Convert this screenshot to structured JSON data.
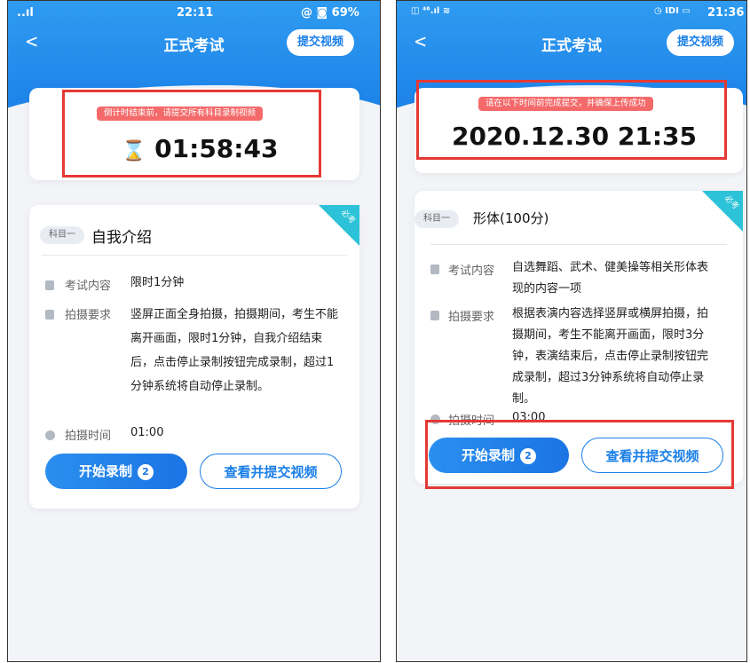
{
  "left": {
    "status": {
      "time": "22:11",
      "battery": "@ ◙ 69%",
      "signal": "..ıl"
    },
    "nav": {
      "back": "<",
      "title": "正式考试",
      "submit": "提交视频"
    },
    "timer": {
      "notice": "倒计时结束前，请提交所有科目录制视频",
      "icon": "hourglass-icon",
      "hourglass": "⌛",
      "value": "01:58:43"
    },
    "subject": {
      "tag": "科目一",
      "name": "自我介绍",
      "corner_label": "必考",
      "rows": [
        {
          "icon": "document-icon",
          "label": "考试内容",
          "value": "限时1分钟"
        },
        {
          "icon": "video-icon",
          "label": "拍摄要求",
          "value": "竖屏正面全身拍摄，拍摄期间，考生不能离开画面，限时1分钟，自我介绍结束后，点击停止录制按钮完成录制，超过1分钟系统将自动停止录制。"
        },
        {
          "icon": "clock-icon",
          "label": "拍摄时间",
          "value": "01:00"
        }
      ],
      "record_btn": "开始录制",
      "record_count": "2",
      "view_btn": "查看并提交视频"
    }
  },
  "right": {
    "status": {
      "time": "21:36",
      "icons": "◫ ⁴⁶.ıl ≋",
      "right_icons": "◷ ⅠDⅠ ▭"
    },
    "nav": {
      "back": "<",
      "title": "正式考试",
      "submit": "提交视频"
    },
    "deadline": {
      "notice": "请在以下时间前完成提交，并确保上传成功",
      "value": "2020.12.30 21:35"
    },
    "subject": {
      "tag": "科目一",
      "name": "形体(100分)",
      "corner_label": "必考",
      "rows": [
        {
          "icon": "document-icon",
          "label": "考试内容",
          "value": "自选舞蹈、武术、健美操等相关形体表现的内容一项"
        },
        {
          "icon": "video-icon",
          "label": "拍摄要求",
          "value": "根据表演内容选择竖屏或横屏拍摄，拍摄期间，考生不能离开画面，限时3分钟，表演结束后，点击停止录制按钮完成录制，超过3分钟系统将自动停止录制。"
        },
        {
          "icon": "clock-icon",
          "label": "拍摄时间",
          "value": "03:00"
        }
      ],
      "record_btn": "开始录制",
      "record_count": "2",
      "view_btn": "查看并提交视频"
    }
  },
  "colors": {
    "accent": "#1a7fe8",
    "highlight": "#e53935",
    "notice": "#f46a6a",
    "corner": "#2cc2d8"
  }
}
